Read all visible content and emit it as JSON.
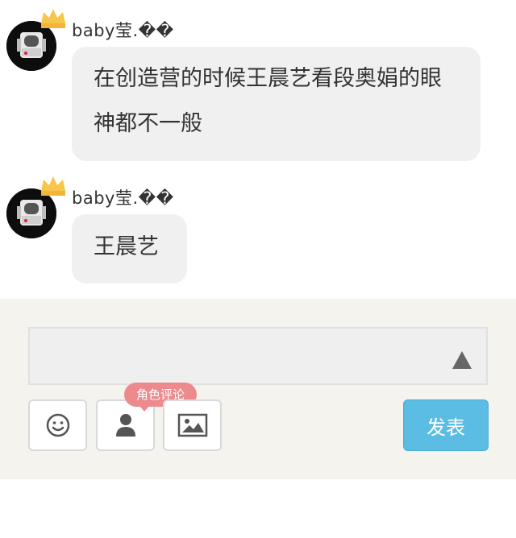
{
  "messages": [
    {
      "username": "baby莹.��",
      "text": "在创造营的时候王晨艺看段奥娟的眼神都不一般"
    },
    {
      "username": "baby莹.��",
      "text": "王晨艺"
    }
  ],
  "composer": {
    "input_value": "",
    "role_comment_tag": "角色评论",
    "send_label": "发表"
  },
  "colors": {
    "bubble": "#f0f0f0",
    "composer_bg": "#f4f3ee",
    "send_button": "#5bbde3",
    "tag": "#ec8a8e",
    "crown": "#f7c64a"
  },
  "icons": [
    "avatar-astronaut",
    "crown-icon",
    "emoji-icon",
    "person-icon",
    "image-icon",
    "collapse-triangle-icon"
  ]
}
